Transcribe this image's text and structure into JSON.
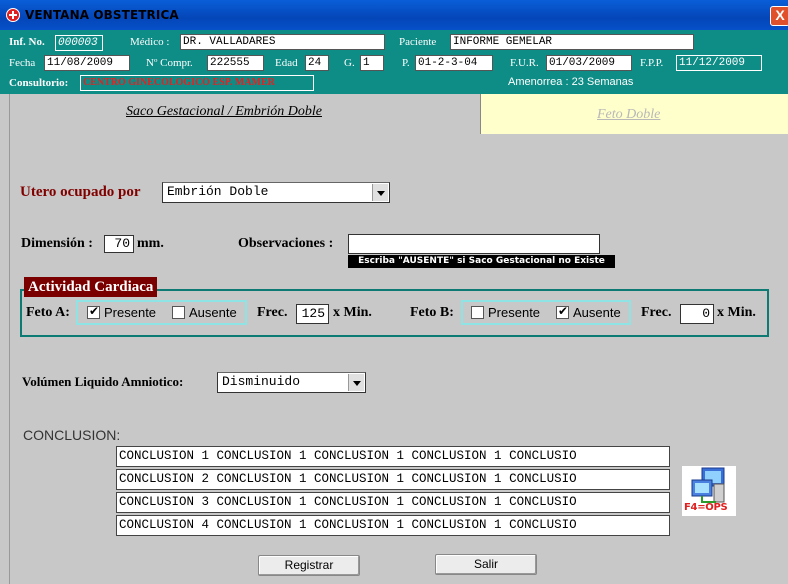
{
  "window": {
    "title": "VENTANA OBSTETRICA",
    "close_label": "X"
  },
  "header": {
    "inf_no_label": "Inf. No.",
    "inf_no": "000003",
    "medico_label": "Médico :",
    "medico": "DR. VALLADARES",
    "paciente_label": "Paciente",
    "paciente": "INFORME GEMELAR",
    "fecha_label": "Fecha",
    "fecha": "11/08/2009",
    "ncompr_label": "Nº Compr.",
    "ncompr": "222555",
    "edad_label": "Edad",
    "edad": "24",
    "g_label": "G.",
    "g": "1",
    "p_label": "P.",
    "p": "01-2-3-04",
    "fur_label": "F.U.R.",
    "fur": "01/03/2009",
    "fpp_label": "F.P.P.",
    "fpp": "11/12/2009",
    "consultorio_label": "Consultorio:",
    "consultorio": "CENTRO GINECOLOGICO ESP. MAMER",
    "amenorrea": "Amenorrea : 23 Semanas"
  },
  "tabs": [
    {
      "label": "Saco Gestacional / Embrión Doble",
      "active": true
    },
    {
      "label": "Feto Doble",
      "active": false
    }
  ],
  "form": {
    "utero_label": "Utero ocupado por",
    "utero_value": "Embrión Doble",
    "dimension_label": "Dimensión :",
    "dimension_value": "70",
    "dimension_unit": "mm.",
    "observaciones_label": "Observaciones :",
    "observaciones_value": "",
    "hint": "Escriba \"AUSENTE\" si Saco Gestacional no Existe",
    "actividad_title": "Actividad Cardiaca",
    "feto_a_label": "Feto A:",
    "feto_a_presente": "Presente",
    "feto_a_ausente": "Ausente",
    "feto_a_frec_label": "Frec.",
    "feto_a_frec": "125",
    "feto_a_unit": "x Min.",
    "feto_b_label": "Feto B:",
    "feto_b_presente": "Presente",
    "feto_b_ausente": "Ausente",
    "feto_b_frec_label": "Frec.",
    "feto_b_frec": "0",
    "feto_b_unit": "x Min.",
    "liquido_label": "Volúmen Liquido Amniotico:",
    "liquido_value": "Disminuido",
    "conclusion_label": "CONCLUSION:",
    "conclusions": [
      "CONCLUSION 1 CONCLUSION 1 CONCLUSION 1 CONCLUSION 1 CONCLUSIO",
      "CONCLUSION 2 CONCLUSION 1 CONCLUSION 1 CONCLUSION 1 CONCLUSIO",
      "CONCLUSION 3 CONCLUSION 1 CONCLUSION 1 CONCLUSION 1 CONCLUSIO",
      "CONCLUSION 4 CONCLUSION 1 CONCLUSION 1 CONCLUSION 1 CONCLUSIO"
    ],
    "ops_icon_label": "F4=OPS"
  },
  "buttons": {
    "registrar": "Registrar",
    "salir": "Salir"
  },
  "colors": {
    "header_bg": "#0e8c86",
    "titlebar": "#0a5ed8",
    "tab_inactive_bg": "#ffffcc",
    "maroon": "#800000"
  }
}
